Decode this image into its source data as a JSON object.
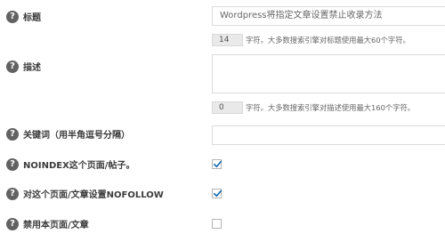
{
  "fields": {
    "title": {
      "label": "标题",
      "value": "Wordpress将指定文章设置禁止收录方法",
      "count": "14",
      "hint": "字符。大多数搜索引擎对标题使用最大60个字符。"
    },
    "description": {
      "label": "描述",
      "value": "",
      "count": "0",
      "hint": "字符。大多数搜索引擎对描述使用最大160个字符。"
    },
    "keywords": {
      "label": "关键词（用半角逗号分隔）",
      "value": ""
    },
    "noindex": {
      "label": "NOINDEX这个页面/帖子。",
      "checked": true
    },
    "nofollow": {
      "label": "对这个页面/文章设置NOFOLLOW",
      "checked": true
    },
    "disable": {
      "label": "禁用本页面/文章",
      "checked": false
    }
  },
  "icons": {
    "help": "question-circle-icon",
    "check": "checkmark-icon"
  },
  "colors": {
    "check": "#2271b1",
    "help_icon_bg": "#626262"
  }
}
